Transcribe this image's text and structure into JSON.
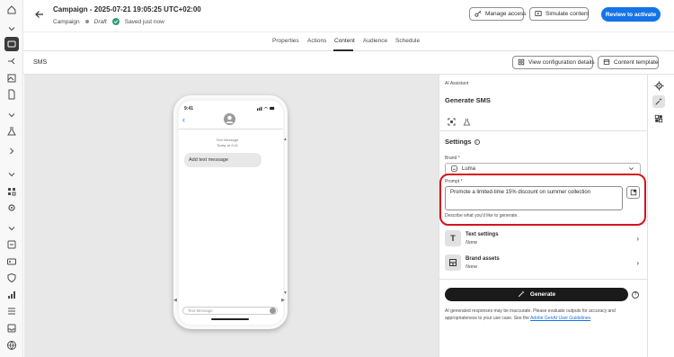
{
  "header": {
    "title": "Campaign - 2025-07-21 19:05:25 UTC+02:00",
    "breadcrumb": "Campaign",
    "status": "Draft",
    "saved": "Saved just now",
    "manage_access": "Manage access",
    "simulate": "Simulate content",
    "review": "Review to activate"
  },
  "tabs": [
    "Properties",
    "Actions",
    "Content",
    "Audience",
    "Schedule"
  ],
  "active_tab": "Content",
  "subheader": {
    "channel": "SMS",
    "view_config": "View configuration details",
    "content_template": "Content template"
  },
  "phone": {
    "time": "9:41",
    "message_meta_1": "Text Message",
    "message_meta_2": "Today at 9:41",
    "bubble_text": "Add text message",
    "input_placeholder": "Text Message"
  },
  "panel": {
    "ai_label": "AI Assistant",
    "heading": "Generate SMS",
    "settings": "Settings",
    "brand_label": "Brand",
    "brand_value": "Luma",
    "prompt_label": "Prompt",
    "prompt_value": "Promote a limited-time 15% discount on summer collection",
    "prompt_help": "Describe what you'd like to generate.",
    "text_settings": "Text settings",
    "text_settings_value": "None",
    "brand_assets": "Brand assets",
    "brand_assets_value": "None",
    "generate": "Generate",
    "disclaimer_1": "AI generated responses may be inaccurate. Please evaluate outputs for accuracy and appropriateness to your use case. See the",
    "disclaimer_link": "Adobe GenAI User Guidelines",
    "disclaimer_end": "."
  },
  "colors": {
    "accent": "#1473e6",
    "highlight": "#d7121c",
    "success": "#2d9d78",
    "dark": "#1a1a1a"
  }
}
